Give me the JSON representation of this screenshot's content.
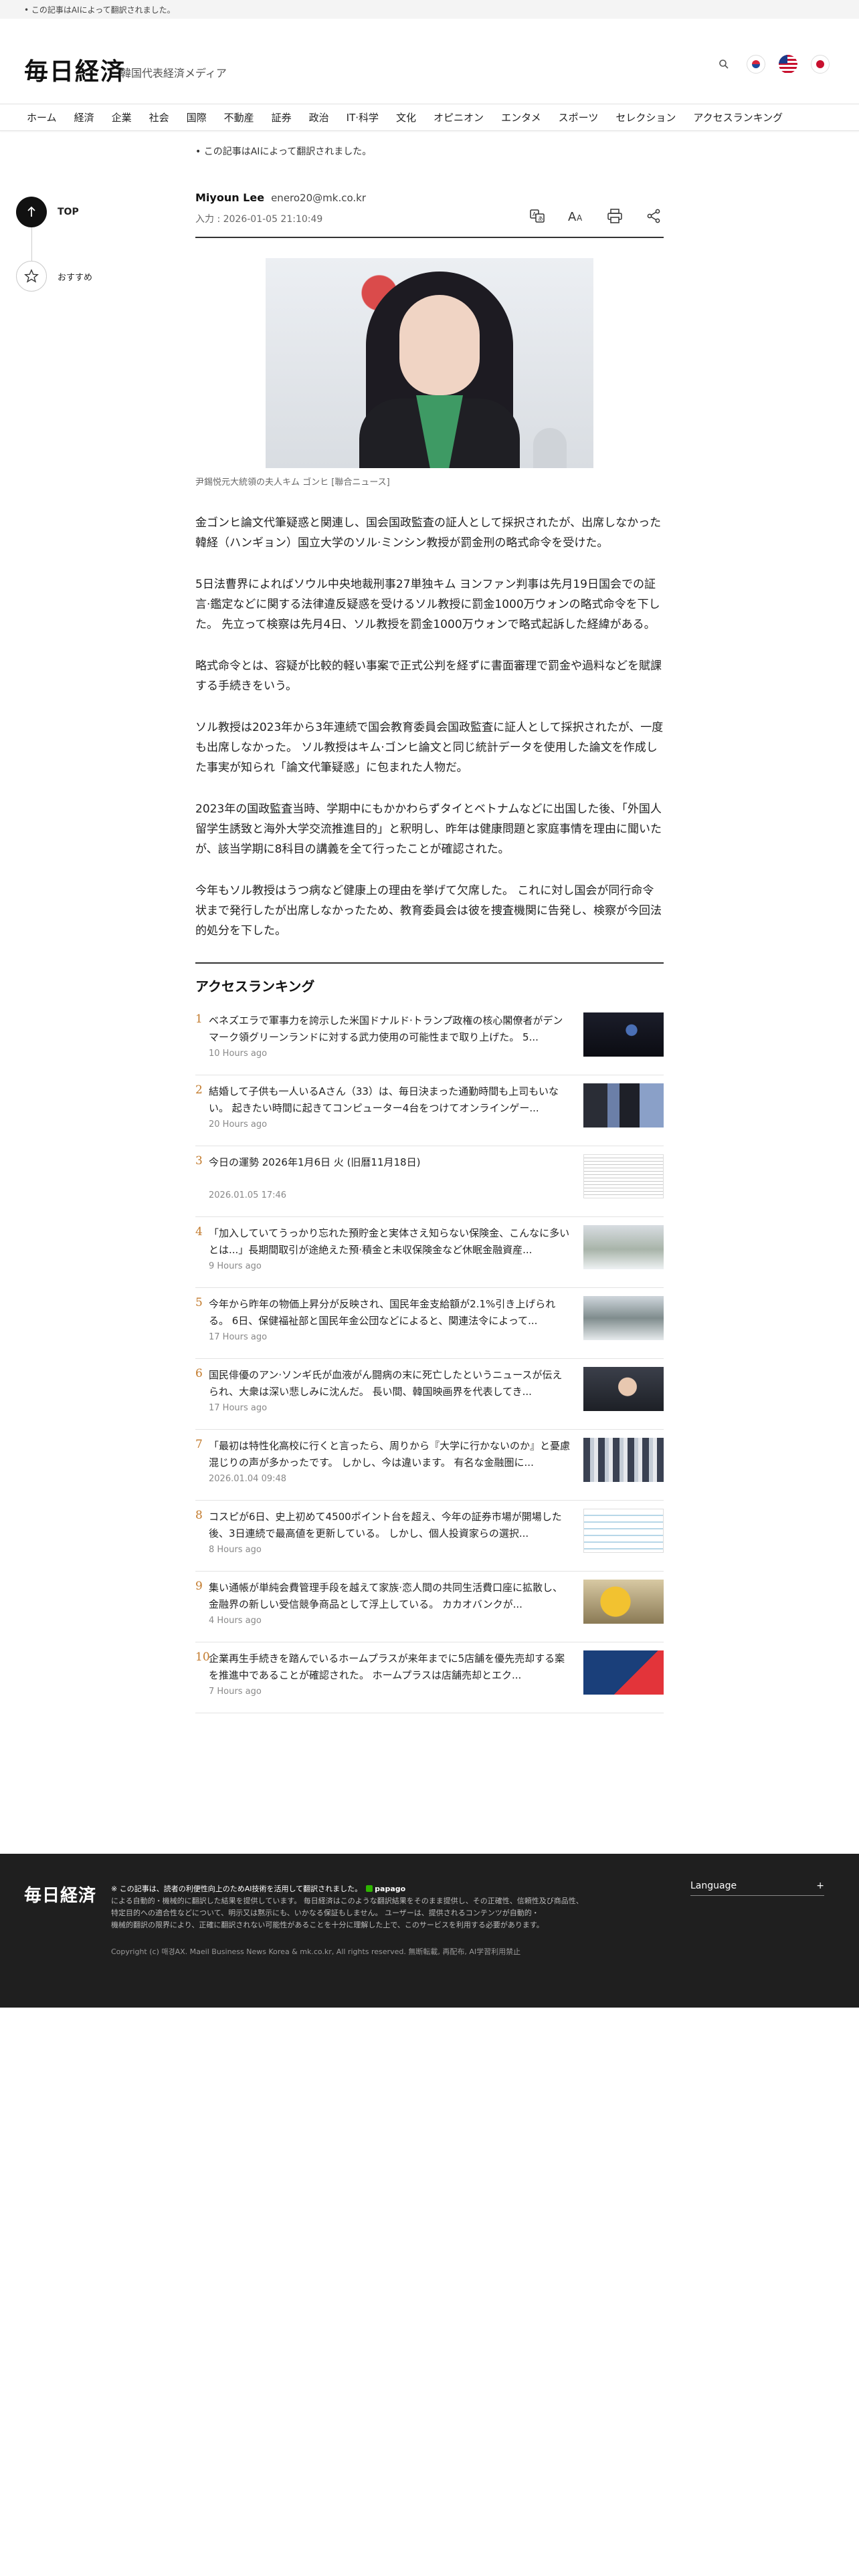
{
  "top_notice": "• この記事はAIによって翻訳されました。",
  "header": {
    "logo": "毎日経済",
    "tagline": "韓国代表経済メディア"
  },
  "nav": [
    "ホーム",
    "経済",
    "企業",
    "社会",
    "国際",
    "不動産",
    "証券",
    "政治",
    "IT·科学",
    "文化",
    "オピニオン",
    "エンタメ",
    "スポーツ",
    "セレクション",
    "アクセスランキング"
  ],
  "sidebar": {
    "top_label": "TOP",
    "recommend_label": "おすすめ"
  },
  "article": {
    "ai_note": "• この記事はAIによって翻訳されました。",
    "author": "Miyoun Lee",
    "email": "enero20@mk.co.kr",
    "date": "入力 : 2026-01-05 21:10:49",
    "caption": "尹錫悦元大統領の夫人キム ゴンヒ [聯合ニュース]",
    "paragraphs": [
      "金ゴンヒ論文代筆疑惑と関連し、国会国政監査の証人として採択されたが、出席しなかった韓経（ハンギョン）国立大学のソル·ミンシン教授が罰金刑の略式命令を受けた。",
      "5日法曹界によればソウル中央地裁刑事27単独キム ヨンファン判事は先月19日国会での証言·鑑定などに関する法律違反疑惑を受けるソル教授に罰金1000万ウォンの略式命令を下した。 先立って検察は先月4日、ソル教授を罰金1000万ウォンで略式起訴した経緯がある。",
      "略式命令とは、容疑が比較的軽い事案で正式公判を経ずに書面審理で罰金や過料などを賦課する手続きをいう。",
      "ソル教授は2023年から3年連続で国会教育委員会国政監査に証人として採択されたが、一度も出席しなかった。 ソル教授はキム·ゴンヒ論文と同じ統計データを使用した論文を作成した事実が知られ「論文代筆疑惑」に包まれた人物だ。",
      "2023年の国政監査当時、学期中にもかかわらずタイとベトナムなどに出国した後、「外国人留学生誘致と海外大学交流推進目的」と釈明し、昨年は健康問題と家庭事情を理由に聞いたが、該当学期に8科目の講義を全て行ったことが確認された。",
      "今年もソル教授はうつ病など健康上の理由を挙げて欠席した。 これに対し国会が同行命令状まで発行したが出席しなかったため、教育委員会は彼を捜査機関に告発し、検察が今回法的処分を下した。"
    ]
  },
  "ranking": {
    "title": "アクセスランキング",
    "items": [
      {
        "num": "1",
        "text": "ベネズエラで軍事力を誇示した米国ドナルド·トランプ政権の核心閣僚者がデンマーク領グリーンランドに対する武力使用の可能性まで取り上げた。 5...",
        "time": "10 Hours ago",
        "thumb": "dark-stage"
      },
      {
        "num": "2",
        "text": "結婚して子供も一人いるAさん（33）は、毎日決まった通勤時間も上司もいない。 起きたい時間に起きてコンピューター4台をつけてオンラインゲー...",
        "time": "20 Hours ago",
        "thumb": "monitors"
      },
      {
        "num": "3",
        "text": "今日の運勢 2026年1月6日 火 (旧暦11月18日)",
        "time": "2026.01.05 17:46",
        "thumb": "text-doc"
      },
      {
        "num": "4",
        "text": "「加入していてうっかり忘れた預貯金と実体さえ知らない保険金、こんなに多いとは...」長期間取引が途絶えた預·積金と未収保険金など休眠金融資産...",
        "time": "9 Hours ago",
        "thumb": "snow-trees"
      },
      {
        "num": "5",
        "text": "今年から昨年の物価上昇分が反映され、国民年金支給額が2.1%引き上げられる。 6日、保健福祉部と国民年金公団などによると、関連法令によって...",
        "time": "17 Hours ago",
        "thumb": "snow-city"
      },
      {
        "num": "6",
        "text": "国民俳優のアン·ソンギ氏が血液がん闘病の末に死亡したというニュースが伝えられ、大衆は深い悲しみに沈んだ。 長い間、韓国映画界を代表してき...",
        "time": "17 Hours ago",
        "thumb": "portrait"
      },
      {
        "num": "7",
        "text": "「最初は特性化高校に行くと言ったら、周りから『大学に行かないのか』と憂慮混じりの声が多かったです。 しかし、今は違います。 有名な金融圏に...",
        "time": "2026.01.04 09:48",
        "thumb": "crowd"
      },
      {
        "num": "8",
        "text": "コスピが6日、史上初めて4500ポイント台を超え、今年の証券市場が開場した後、3日連続で最高値を更新している。 しかし、個人投資家らの選択...",
        "time": "8 Hours ago",
        "thumb": "stock-table"
      },
      {
        "num": "9",
        "text": "集い通帳が単純会費管理手段を越えて家族·恋人間の共同生活費口座に拡散し、金融界の新しい受信競争商品として浮上している。 カカオバンクが...",
        "time": "4 Hours ago",
        "thumb": "yellow-card"
      },
      {
        "num": "10",
        "text": "企業再生手続きを踏んでいるホームプラスが来年までに5店舗を優先売却する案を推進中であることが確認された。 ホームプラスは店舗売却とエク...",
        "time": "7 Hours ago",
        "thumb": "homeplus"
      }
    ]
  },
  "footer": {
    "logo": "毎日経済",
    "lead": "※ この記事は、読者の利便性向上のためAI技術を活用して翻訳されました。",
    "papago": "papago",
    "line2": "による自動的・機械的に翻訳した結果を提供しています。 毎日経済はこのような翻訳結果をそのまま提供し、その正確性、信頼性及び商品性、",
    "line3": "特定目的への適合性などについて、明示又は黙示にも、いかなる保証もしません。 ユーザーは、提供されるコンテンツが自動的・",
    "line4": "機械的翻訳の限界により、正確に翻訳されない可能性があることを十分に理解した上で、このサービスを利用する必要があります。",
    "copyright": "Copyright (c) 매경AX. Maeil Business News Korea & mk.co.kr, All rights reserved. 無断転載, 再配布, AI学習利用禁止",
    "language_label": "Language",
    "language_plus": "+"
  },
  "colors": {
    "rank_number": "#c27a2c",
    "footer_bg": "#1f1f1f"
  }
}
